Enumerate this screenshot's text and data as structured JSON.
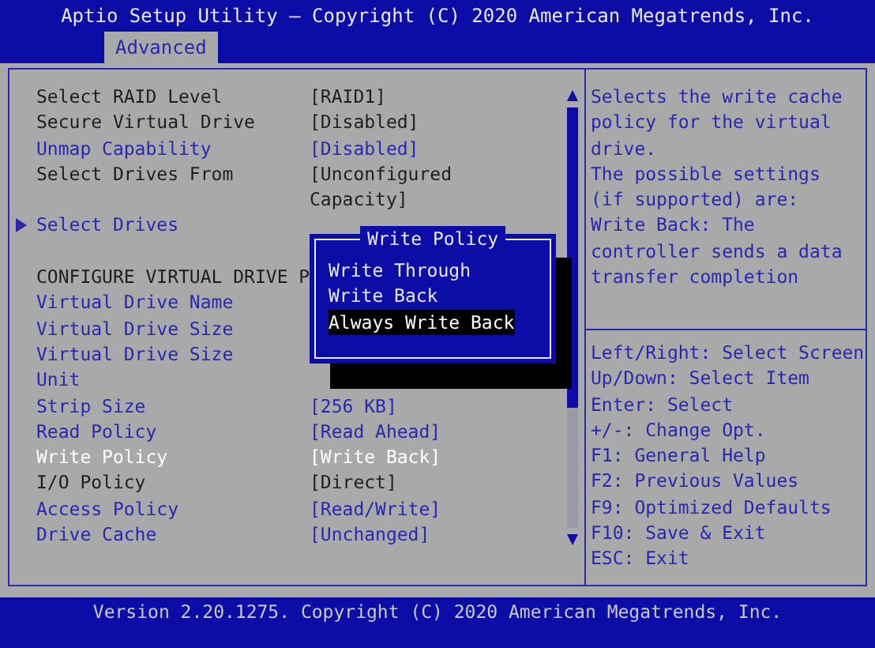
{
  "window": {
    "title": "Aptio Setup Utility – Copyright (C) 2020 American Megatrends, Inc."
  },
  "tabs": [
    {
      "label": "Advanced",
      "selected": true
    }
  ],
  "rows": [
    {
      "kind": "setting",
      "label": "Select RAID Level",
      "value": "[RAID1]",
      "editable": false,
      "selected": false
    },
    {
      "kind": "setting",
      "label": "Secure Virtual Drive",
      "value": "[Disabled]",
      "editable": false,
      "selected": false
    },
    {
      "kind": "setting",
      "label": "Unmap Capability",
      "value": "[Disabled]",
      "editable": true,
      "selected": false
    },
    {
      "kind": "setting",
      "label": "Select Drives From",
      "value": "[Unconfigured Capacity]",
      "editable": false,
      "selected": false
    },
    {
      "kind": "submenu",
      "label": "Select Drives",
      "editable": true,
      "selected": false
    },
    {
      "kind": "blank"
    },
    {
      "kind": "heading",
      "label": "CONFIGURE VIRTUAL DRIVE P"
    },
    {
      "kind": "setting",
      "label": "Virtual Drive Name",
      "editable": true,
      "selected": false
    },
    {
      "kind": "setting",
      "label": "Virtual Drive Size",
      "editable": true,
      "selected": false
    },
    {
      "kind": "setting",
      "label": "Virtual Drive Size",
      "editable": true,
      "selected": false
    },
    {
      "kind": "setting",
      "label": "Unit",
      "editable": true,
      "selected": false
    },
    {
      "kind": "setting",
      "label": "Strip Size",
      "value": "[256 KB]",
      "editable": true,
      "selected": false
    },
    {
      "kind": "setting",
      "label": "Read Policy",
      "value": "[Read Ahead]",
      "editable": true,
      "selected": false
    },
    {
      "kind": "setting",
      "label": "Write Policy",
      "value": "[Write Back]",
      "editable": true,
      "selected": true
    },
    {
      "kind": "setting",
      "label": "I/O Policy",
      "value": "[Direct]",
      "editable": false,
      "selected": false
    },
    {
      "kind": "setting",
      "label": "Access Policy",
      "value": "[Read/Write]",
      "editable": true,
      "selected": false
    },
    {
      "kind": "setting",
      "label": "Drive Cache",
      "value": "[Unchanged]",
      "editable": true,
      "selected": false
    }
  ],
  "popup": {
    "title": "Write Policy",
    "options": [
      {
        "label": "Write Through",
        "selected": false
      },
      {
        "label": "Write Back",
        "selected": false
      },
      {
        "label": "Always Write Back",
        "selected": true
      }
    ]
  },
  "help": {
    "paragraphs": [
      "Selects the write cache policy for the virtual drive.",
      "The possible settings (if supported) are:",
      "Write Back: The controller sends a data transfer completion"
    ]
  },
  "key_hints": [
    "Left/Right: Select Screen",
    "Up/Down: Select Item",
    "Enter: Select",
    "+/-: Change Opt.",
    "F1: General Help",
    "F2: Previous Values",
    "F9: Optimized Defaults",
    "F10: Save & Exit",
    "ESC: Exit"
  ],
  "status_bar": "Version 2.20.1275. Copyright (C) 2020 American Megatrends, Inc."
}
